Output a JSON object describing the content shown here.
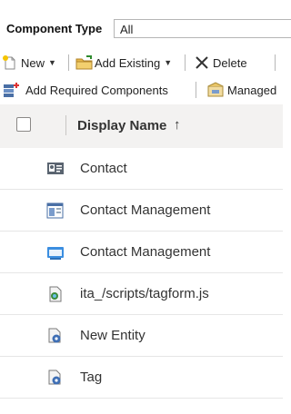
{
  "filter": {
    "label": "Component Type",
    "selected": "All"
  },
  "toolbar1": {
    "new_label": "New",
    "add_existing_label": "Add Existing",
    "delete_label": "Delete"
  },
  "toolbar2": {
    "add_required_label": "Add Required Components",
    "managed_label": "Managed"
  },
  "grid": {
    "header": {
      "display_name": "Display Name",
      "sort_arrow": "↑"
    },
    "rows": [
      {
        "name": "Contact",
        "icon": "contact-card-icon"
      },
      {
        "name": "Contact Management",
        "icon": "form-icon"
      },
      {
        "name": "Contact Management",
        "icon": "view-icon"
      },
      {
        "name": "ita_/scripts/tagform.js",
        "icon": "script-web-resource-icon"
      },
      {
        "name": "New Entity",
        "icon": "entity-gear-icon"
      },
      {
        "name": "Tag",
        "icon": "entity-gear-icon"
      }
    ]
  }
}
